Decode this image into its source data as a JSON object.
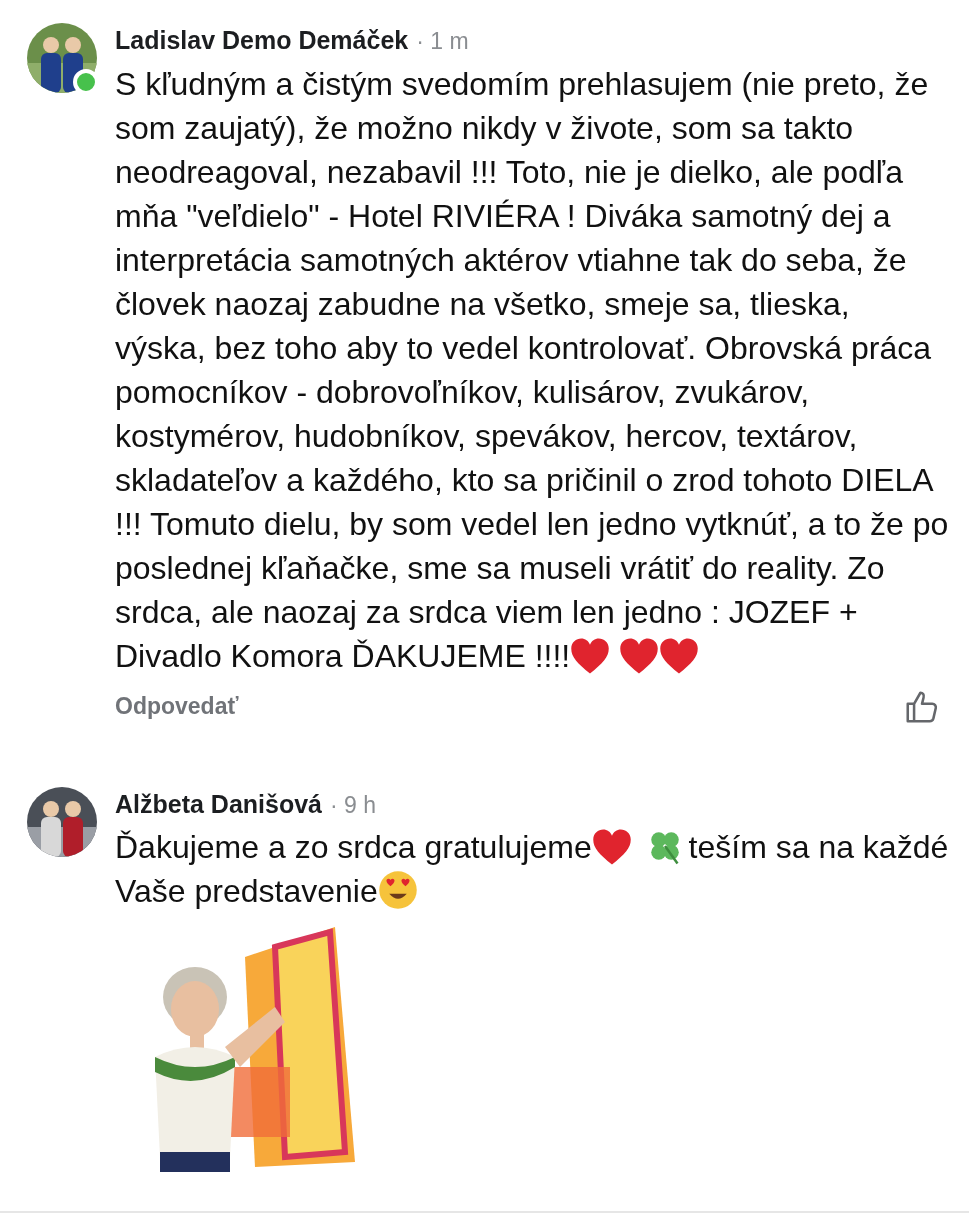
{
  "comments": [
    {
      "author": "Ladislav Demo Demáček",
      "time": "· 1 m",
      "online": true,
      "avatar": {
        "kind": "picture"
      },
      "body": [
        {
          "kind": "text",
          "text": "S kľudným a čistým svedomím prehlasujem (nie preto, že som zaujatý), že možno nikdy v živote, som sa takto neodreagoval, nezabavil !!! Toto, nie je dielko, ale podľa mňa \"veľdielo\" - Hotel RIVIÉRA ! Diváka samotný dej a interpretácia samotných aktérov vtiahne tak do seba, že človek naozaj zabudne na všetko, smeje sa, tlieska, výska, bez toho aby to vedel kontrolovať. Obrovská práca pomocníkov - dobrovoľníkov,  kulisárov, zvukárov, kostymérov, hudobníkov, spevákov, hercov, textárov, skladateľov a každého, kto sa pričinil o zrod tohoto DIELA !!! Tomuto dielu, by som vedel len jedno vytknúť, a to že po poslednej kľaňačke, sme sa museli vrátiť do reality. Zo srdca, ale naozaj za srdca viem len jedno : JOZEF + Divadlo Komora ĎAKUJEME !!!!"
        },
        {
          "kind": "heart"
        },
        {
          "kind": "space"
        },
        {
          "kind": "heart"
        },
        {
          "kind": "heart"
        }
      ],
      "reply": "Odpovedať"
    },
    {
      "author": "Alžbeta Danišová",
      "time": "· 9 h",
      "online": false,
      "avatar": {
        "kind": "picture"
      },
      "body": [
        {
          "kind": "text",
          "text": "Ďakujeme a zo srdca gratulujeme"
        },
        {
          "kind": "heart"
        },
        {
          "kind": "space"
        },
        {
          "kind": "clover"
        },
        {
          "kind": "text",
          "text": "teším sa na každé Vaše predstavenie"
        },
        {
          "kind": "hearteyes"
        }
      ],
      "attachment": {
        "kind": "picture"
      }
    }
  ]
}
